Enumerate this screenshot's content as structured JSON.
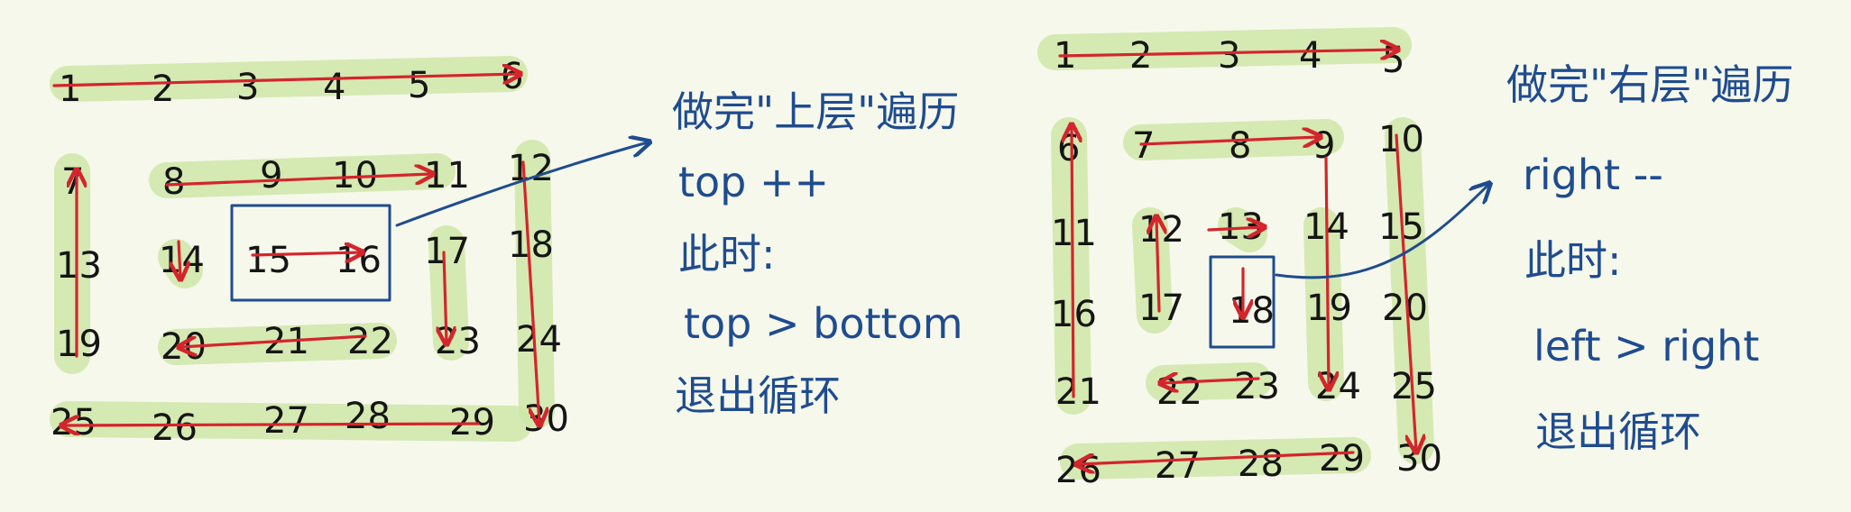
{
  "left": {
    "grid": [
      [
        "1",
        "2",
        "3",
        "4",
        "5",
        "6"
      ],
      [
        "7",
        "8",
        "9",
        "10",
        "11",
        "12"
      ],
      [
        "13",
        "14",
        "15",
        "16",
        "17",
        "18"
      ],
      [
        "19",
        "20",
        "21",
        "22",
        "23",
        "24"
      ],
      [
        "25",
        "26",
        "27",
        "28",
        "29",
        "30"
      ]
    ],
    "note": [
      "做完\"上层\"遍历",
      "top ++",
      "此时:",
      "top > bottom",
      "退出循环"
    ]
  },
  "right": {
    "grid": [
      [
        "1",
        "2",
        "3",
        "4",
        "5"
      ],
      [
        "6",
        "7",
        "8",
        "9",
        "10"
      ],
      [
        "11",
        "12",
        "13",
        "14",
        "15"
      ],
      [
        "16",
        "17",
        "18",
        "19",
        "20"
      ],
      [
        "21",
        "22",
        "23",
        "24",
        "25"
      ],
      [
        "26",
        "27",
        "28",
        "29",
        "30"
      ]
    ],
    "note": [
      "做完\"右层\"遍历",
      "right --",
      "此时:",
      "left > right",
      "退出循环"
    ]
  },
  "colors": {
    "highlight": "#cfe6a8",
    "arrow": "#d4252c",
    "ink": "#1f4c8f",
    "numbers": "#151515",
    "background": "#f6f8ec"
  }
}
